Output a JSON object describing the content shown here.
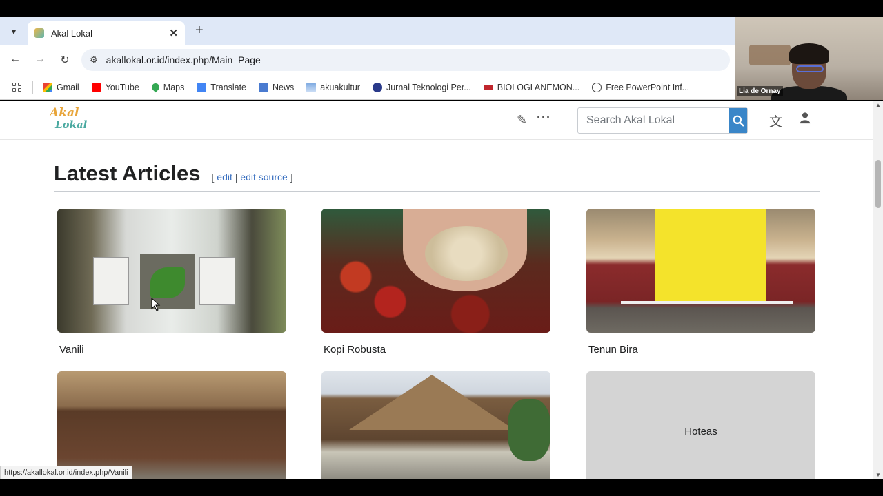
{
  "browser": {
    "tab_title": "Akal Lokal",
    "url": "akallokal.or.id/index.php/Main_Page",
    "status_url": "https://akallokal.or.id/index.php/Vanili",
    "bookmarks": [
      {
        "label": "Gmail",
        "icon": "gmail-icon"
      },
      {
        "label": "YouTube",
        "icon": "youtube-icon"
      },
      {
        "label": "Maps",
        "icon": "maps-icon"
      },
      {
        "label": "Translate",
        "icon": "translate-icon"
      },
      {
        "label": "News",
        "icon": "news-icon"
      },
      {
        "label": "akuakultur",
        "icon": "page-icon"
      },
      {
        "label": "Jurnal Teknologi Per...",
        "icon": "journal-icon"
      },
      {
        "label": "BIOLOGI ANEMON...",
        "icon": "biology-icon"
      },
      {
        "label": "Free PowerPoint Inf...",
        "icon": "smiley-icon"
      }
    ]
  },
  "webcam": {
    "name": "Lia de Ornay"
  },
  "site": {
    "search_placeholder": "Search Akal Lokal",
    "heading": "Latest Articles",
    "edit_open": "[",
    "edit": "edit",
    "edit_sep": "|",
    "edit_source": "edit source",
    "edit_close": "]",
    "articles": [
      {
        "title": "Vanili"
      },
      {
        "title": "Kopi Robusta"
      },
      {
        "title": "Tenun Bira"
      },
      {
        "title": ""
      },
      {
        "title": ""
      },
      {
        "title": "Hoteas"
      }
    ]
  },
  "colors": {
    "accent_blue": "#3a86c8",
    "link_blue": "#3a70c0",
    "tab_strip": "#dfe8f7"
  }
}
